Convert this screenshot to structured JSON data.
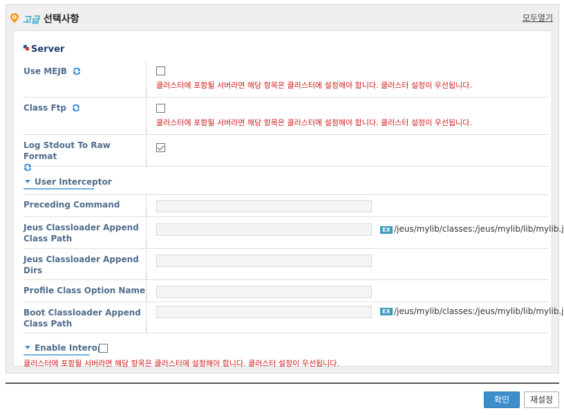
{
  "header": {
    "adv_word": "고급",
    "title": "선택사항",
    "expand_all": "모두열기"
  },
  "section": {
    "title": "Server"
  },
  "warning_text": "클러스터에 포함될 서버라면 해당 항목은 클러스터에 설정해야 합니다. 클러스터 설정이 우선됩니다.",
  "rows": {
    "use_mejb": {
      "label": "Use MEJB",
      "checked": false
    },
    "class_ftp": {
      "label": "Class Ftp",
      "checked": false
    },
    "log_stdout": {
      "label": "Log Stdout To Raw Format",
      "checked": true
    }
  },
  "user_interceptor": {
    "title": "User Interceptor",
    "preceding_command": {
      "label": "Preceding Command",
      "value": ""
    },
    "jeus_cl_append_cp": {
      "label": "Jeus Classloader Append Class Path",
      "value": "",
      "example": "/jeus/mylib/classes:/jeus/mylib/lib/mylib.jar"
    },
    "jeus_cl_append_dirs": {
      "label": "Jeus Classloader Append Dirs",
      "value": ""
    },
    "profile_class_option": {
      "label": "Profile Class Option Name",
      "value": ""
    },
    "boot_cl_append_cp": {
      "label": "Boot Classloader Append Class Path",
      "value": "",
      "example": "/jeus/mylib/classes:/jeus/mylib/lib/mylib.jar"
    }
  },
  "enable_interop": {
    "title": "Enable Interop",
    "checked": false
  },
  "ex_badge": "EX",
  "buttons": {
    "ok": "확인",
    "reset": "재설정"
  },
  "colors": {
    "accent": "#3d8fcc",
    "warning": "#d01b1b",
    "label": "#4f6d8c"
  },
  "icons": {
    "refresh": "refresh-icon",
    "advanced": "advanced-badge-icon"
  }
}
